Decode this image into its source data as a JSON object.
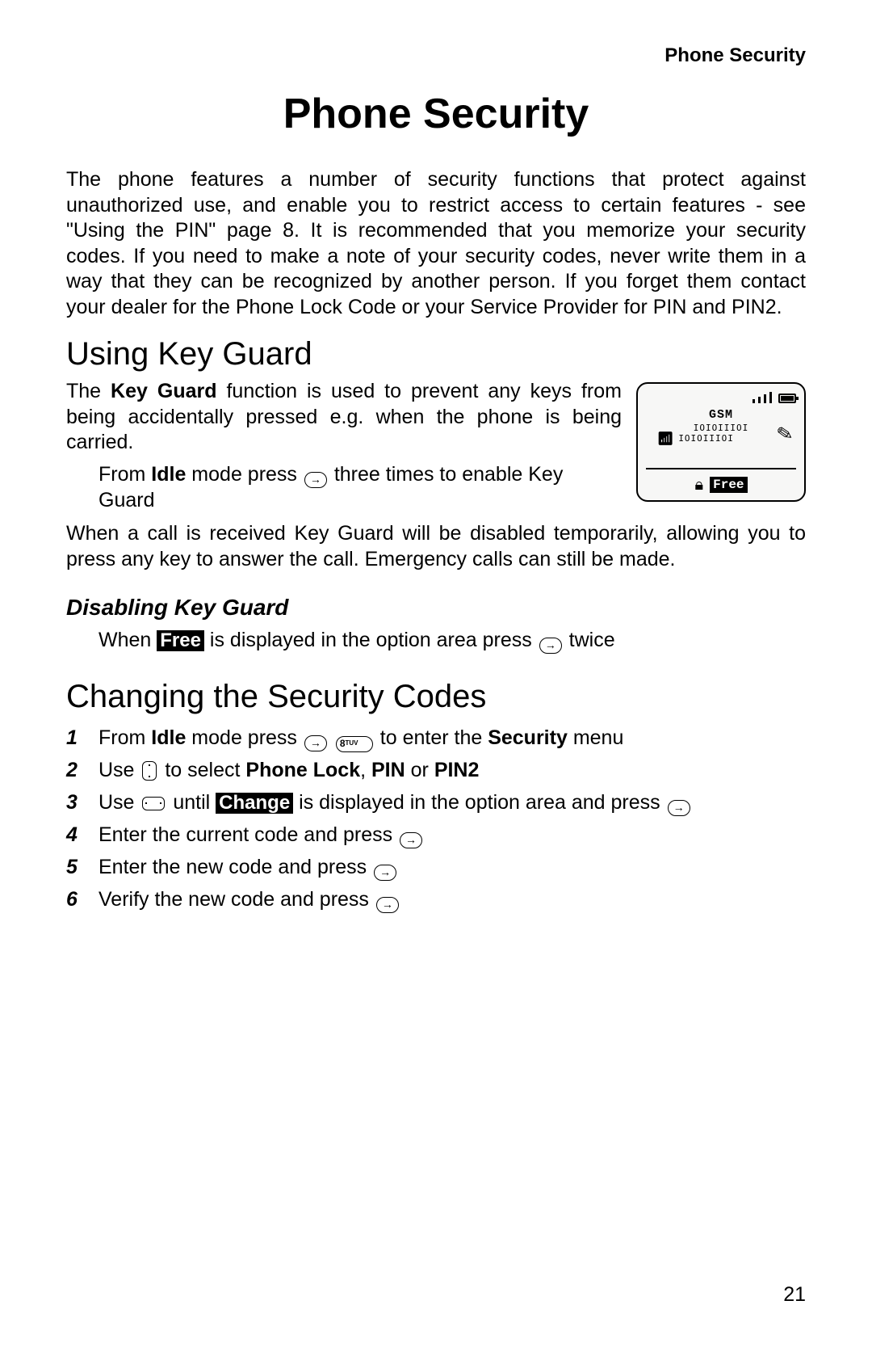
{
  "header": {
    "section_label": "Phone Security"
  },
  "title": "Phone Security",
  "intro": "The phone features a number of security functions that protect against unauthorized use, and enable you to restrict access to certain features - see \"Using the PIN\" page 8. It is recommended that you memorize your security codes. If you need to make a note of your security codes, never write them in a way that they can be recognized by another person. If you forget them contact your dealer for the Phone Lock Code or your Service Provider for PIN and PIN2.",
  "section_keyguard": {
    "heading": "Using Key Guard",
    "para1_pre": "The ",
    "para1_bold": "Key Guard",
    "para1_post": " function is used to prevent any keys from being accidentally pressed e.g. when the phone is being carried.",
    "instr_pre": "From ",
    "instr_bold1": "Idle",
    "instr_mid": " mode press ",
    "instr_post": " three times to enable Key Guard",
    "para2": "When a call is received Key Guard will be disabled temporarily, allowing you to press any key to answer the call. Emergency calls can still be made."
  },
  "screen": {
    "gsm": "GSM",
    "barcode1": "IOIOIIIOI",
    "barcode2": "IOIOIIIOI",
    "free": "Free"
  },
  "subsection_disable": {
    "heading": "Disabling Key Guard",
    "pre": "When ",
    "badge": "Free",
    "mid": " is displayed in the option area press ",
    "post": " twice"
  },
  "section_changing": {
    "heading": "Changing the Security Codes",
    "steps": [
      {
        "t1": "From ",
        "b1": "Idle",
        "t2": " mode press ",
        "icons": [
          "round",
          "key8"
        ],
        "t3": " to enter the ",
        "b2": "Security",
        "t4": " menu"
      },
      {
        "t1": "Use ",
        "icons": [
          "tall"
        ],
        "t2": " to select ",
        "b1": "Phone Lock",
        "t3": ", ",
        "b2": "PIN",
        "t4": " or ",
        "b3": "PIN2"
      },
      {
        "t1": "Use ",
        "icons": [
          "wide"
        ],
        "t2": " until ",
        "badge": "Change",
        "t3": " is displayed in the option area and press ",
        "icons2": [
          "round"
        ]
      },
      {
        "t1": "Enter the current code and press ",
        "icons": [
          "round"
        ]
      },
      {
        "t1": "Enter the new code and press ",
        "icons": [
          "round"
        ]
      },
      {
        "t1": "Verify the new code and press ",
        "icons": [
          "round"
        ]
      }
    ]
  },
  "page_number": "21"
}
